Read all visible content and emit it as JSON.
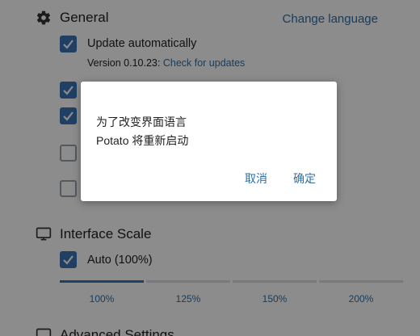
{
  "general": {
    "title": "General",
    "change_language": "Change language",
    "update_automatically": "Update automatically",
    "version_prefix": "Version 0.10.23:",
    "check_updates": "Check for updates"
  },
  "interface_scale": {
    "title": "Interface Scale",
    "auto_label": "Auto (100%)",
    "options": [
      "100%",
      "125%",
      "150%",
      "200%"
    ],
    "selected_index": 0
  },
  "advanced": {
    "title": "Advanced Settings"
  },
  "dialog": {
    "line1": "为了改变界面语言",
    "line2": "Potato 将重新启动",
    "cancel": "取消",
    "confirm": "确定"
  },
  "colors": {
    "accent": "#3b74b5",
    "link": "#2f6fa6",
    "overlay": "rgba(0,0,0,0.45)"
  }
}
